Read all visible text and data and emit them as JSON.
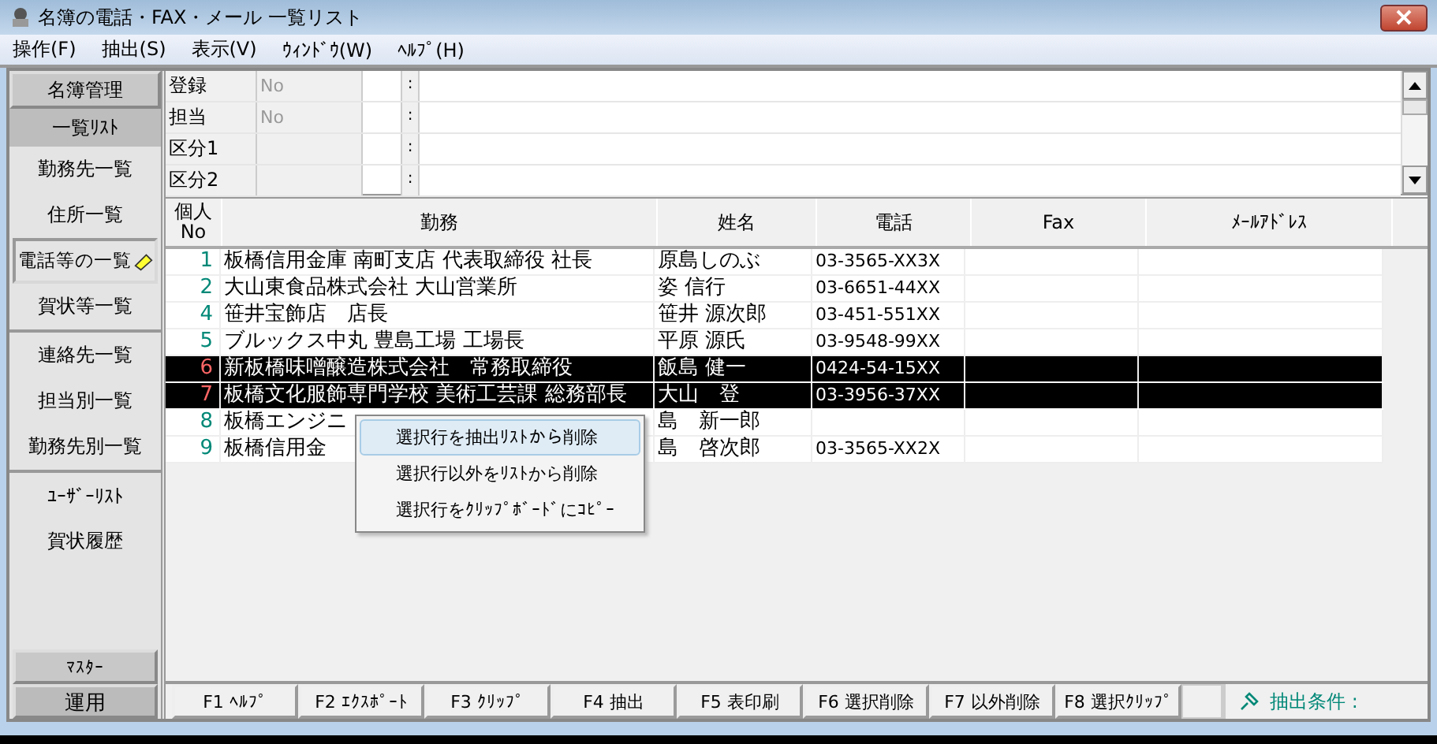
{
  "window": {
    "title": "名簿の電話・FAX・メール 一覧リスト"
  },
  "menu": [
    "操作(F)",
    "抽出(S)",
    "表示(V)",
    "ｳｨﾝﾄﾞｳ(W)",
    "ﾍﾙﾌﾟ(H)"
  ],
  "sidebar": {
    "items": [
      {
        "label": "名簿管理",
        "kind": "header",
        "selected": false
      },
      {
        "label": "一覧ﾘｽﾄ",
        "kind": "header",
        "selected": true
      },
      {
        "label": "勤務先一覧",
        "kind": "item",
        "selected": false
      },
      {
        "label": "住所一覧",
        "kind": "item",
        "selected": false
      },
      {
        "label": "電話等の一覧",
        "kind": "item",
        "selected": true
      },
      {
        "label": "賀状等一覧",
        "kind": "item",
        "selected": false
      },
      {
        "label": "連絡先一覧",
        "kind": "item",
        "selected": false
      },
      {
        "label": "担当別一覧",
        "kind": "item",
        "selected": false
      },
      {
        "label": "勤務先別一覧",
        "kind": "item",
        "selected": false
      },
      {
        "label": "ﾕｰｻﾞｰﾘｽﾄ",
        "kind": "item",
        "selected": false
      },
      {
        "label": "賀状履歴",
        "kind": "item",
        "selected": false
      }
    ],
    "bottom_tabs": [
      {
        "label": "ﾏｽﾀｰ",
        "selected": false
      },
      {
        "label": "運用",
        "selected": true
      }
    ]
  },
  "info_panel": [
    {
      "label": "登録",
      "value": "No",
      "separator": ":"
    },
    {
      "label": "担当",
      "value": "No",
      "separator": ":"
    },
    {
      "label": "区分1",
      "separator": ":"
    },
    {
      "label": "区分2",
      "separator": ":"
    }
  ],
  "table": {
    "columns": [
      {
        "label": "個人",
        "sublabel": "No"
      },
      {
        "label": "勤務"
      },
      {
        "label": "姓名"
      },
      {
        "label": "電話"
      },
      {
        "label": "Fax"
      },
      {
        "label": "ﾒｰﾙｱﾄﾞﾚｽ"
      }
    ],
    "rows": [
      {
        "no": "1",
        "work": "板橋信用金庫 南町支店 代表取締役 社長",
        "name": "原島しのぶ",
        "phone": "03-3565-XX3X",
        "selected": false
      },
      {
        "no": "2",
        "work": "大山東食品株式会社 大山営業所",
        "name": "姿 信行",
        "phone": "03-6651-44XX",
        "selected": false
      },
      {
        "no": "4",
        "work": "笹井宝飾店　店長",
        "name": "笹井 源次郎",
        "phone": "03-451-551XX",
        "selected": false
      },
      {
        "no": "5",
        "work": "ブルックス中丸 豊島工場 工場長",
        "name": "平原 源氏",
        "phone": "03-9548-99XX",
        "selected": false
      },
      {
        "no": "6",
        "work": "新板橋味噌醸造株式会社　常務取締役",
        "name": "飯島 健一",
        "phone": "0424-54-15XX",
        "selected": true
      },
      {
        "no": "7",
        "work": "板橋文化服飾専門学校 美術工芸課 総務部長",
        "name": "大山　登",
        "phone": "03-3956-37XX",
        "selected": true
      },
      {
        "no": "8",
        "work": "板橋エンジニ",
        "name": "島　新一郎",
        "selected": false
      },
      {
        "no": "9",
        "work": "板橋信用金",
        "name": "島　啓次郎",
        "phone": "03-3565-XX2X",
        "selected": false
      }
    ]
  },
  "context_menu": {
    "items": [
      {
        "label": "選択行を抽出ﾘｽﾄから削除",
        "selected": true
      },
      {
        "label": "選択行以外をﾘｽﾄから削除",
        "selected": false
      },
      {
        "label": "選択行をｸﾘｯﾌﾟﾎﾞｰﾄﾞにｺﾋﾟｰ",
        "selected": false
      }
    ]
  },
  "function_keys": [
    "F1 ﾍﾙﾌﾟ",
    "F2 ｴｸｽﾎﾟｰﾄ",
    "F3 ｸﾘｯﾌﾟ",
    "F4 抽出",
    "F5 表印刷",
    "F6 選択削除",
    "F7 以外削除",
    "F8 選択ｸﾘｯﾌﾟ"
  ],
  "status": {
    "filter_label": "抽出条件 :"
  }
}
